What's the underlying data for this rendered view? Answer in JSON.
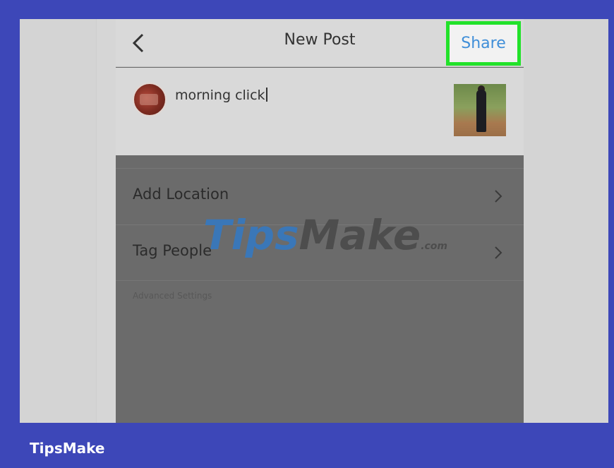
{
  "header": {
    "title": "New Post",
    "share_label": "Share",
    "back_icon": "chevron-left-icon"
  },
  "post": {
    "caption": "morning click",
    "avatar_icon": "avatar",
    "thumbnail": "photo-thumbnail"
  },
  "menu": {
    "items": [
      {
        "label": "Add Location",
        "icon": "chevron-right-icon"
      },
      {
        "label": "Tag People",
        "icon": "chevron-right-icon"
      }
    ],
    "advanced_label": "Advanced Settings"
  },
  "watermark": {
    "part1": "Tips",
    "part2": "Make",
    "suffix": ".com"
  },
  "footer": {
    "brand": "TipsMake"
  },
  "colors": {
    "frame_border": "#3d47b8",
    "highlight": "#22e22a",
    "share_text": "#3f8ed8"
  }
}
